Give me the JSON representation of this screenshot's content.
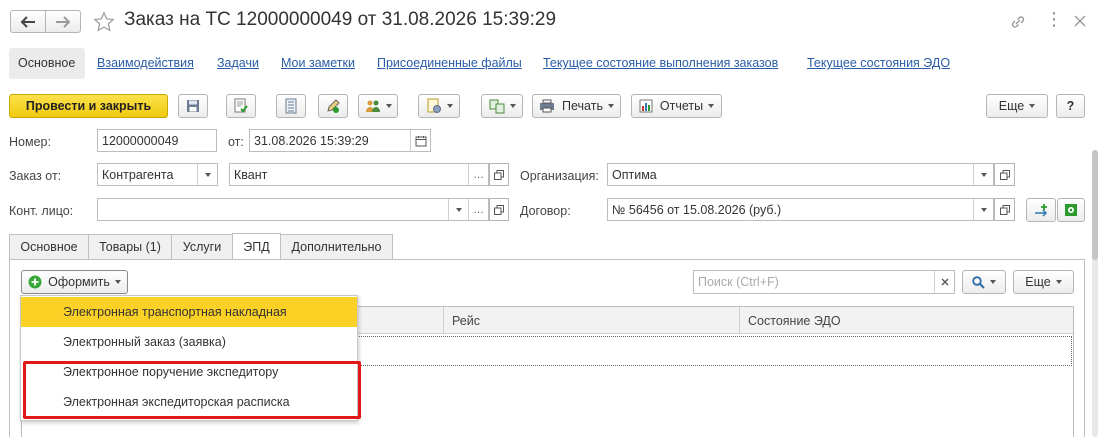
{
  "window": {
    "title": "Заказ на ТС 12000000049 от 31.08.2026 15:39:29"
  },
  "nav_links": {
    "main": "Основное",
    "interactions": "Взаимодействия",
    "tasks": "Задачи",
    "notes": "Мои заметки",
    "files": "Присоединенные файлы",
    "order_status": "Текущее состояние выполнения заказов",
    "edo_status": "Текущее состояния ЭДО"
  },
  "toolbar": {
    "post_close": "Провести и закрыть",
    "print": "Печать",
    "reports": "Отчеты",
    "more": "Еще",
    "help": "?"
  },
  "form": {
    "number_label": "Номер:",
    "number_value": "12000000049",
    "date_label": "от:",
    "date_value": "31.08.2026 15:39:29",
    "order_from_label": "Заказ от:",
    "order_from_value": "Контрагента",
    "counterparty_value": "Квант",
    "organization_label": "Организация:",
    "organization_value": "Оптима",
    "contact_label": "Конт. лицо:",
    "contact_value": "",
    "contract_label": "Договор:",
    "contract_value": "№ 56456 от 15.08.2026 (руб.)"
  },
  "tabs": [
    {
      "label": "Основное"
    },
    {
      "label": "Товары (1)"
    },
    {
      "label": "Услуги"
    },
    {
      "label": "ЭПД"
    },
    {
      "label": "Дополнительно"
    }
  ],
  "epd": {
    "create_button": "Оформить",
    "search_placeholder": "Поиск (Ctrl+F)",
    "more": "Еще",
    "columns": [
      "Рейс",
      "Состояние ЭДО"
    ]
  },
  "dropdown": {
    "items": [
      "Электронная транспортная накладная",
      "Электронный заказ (заявка)",
      "Электронное поручение экспедитору",
      "Электронная экспедиторская расписка"
    ]
  },
  "colors": {
    "primary_button": "#f5d31c",
    "highlight": "#fbd126",
    "annotation": "#e01818",
    "link": "#2a5ca8"
  }
}
